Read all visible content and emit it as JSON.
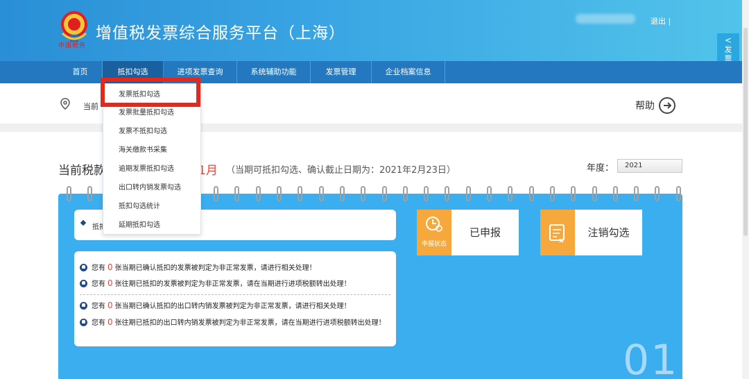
{
  "header": {
    "title": "增值税发票综合服务平台（上海）",
    "logo_script": "中国税务",
    "logout": "退出 |"
  },
  "nav": [
    {
      "label": "首页"
    },
    {
      "label": "抵扣勾选"
    },
    {
      "label": "进项发票查询"
    },
    {
      "label": "系统辅助功能"
    },
    {
      "label": "发票管理"
    },
    {
      "label": "企业档案信息"
    }
  ],
  "side_tab": {
    "label": "发票查验平台",
    "arrow": "<"
  },
  "breadcrumb": {
    "label": "当前"
  },
  "help": {
    "label": "帮助"
  },
  "dropdown": {
    "items": [
      {
        "label": "发票抵扣勾选"
      },
      {
        "label": "发票批量抵扣勾选"
      },
      {
        "label": "发票不抵扣勾选"
      },
      {
        "label": "海关缴款书采集"
      },
      {
        "label": "逾期发票抵扣勾选"
      },
      {
        "label": "出口转内销发票勾选"
      },
      {
        "label": "抵扣勾选统计"
      },
      {
        "label": "延期抵扣勾选"
      }
    ]
  },
  "period": {
    "title_prefix": "当前税款",
    "month": "1月",
    "note": "（当期可抵扣勾选、确认截止日期为：2021年2月23日）",
    "year_label": "年度：",
    "year_value": "2021"
  },
  "card1": {
    "text": "抵扣"
  },
  "notices": [
    {
      "pre": "您有",
      "count": "0",
      "post": "张当期已确认抵扣的发票被判定为非正常发票，请进行相关处理！"
    },
    {
      "pre": "您有",
      "count": "0",
      "post": "张往期已抵扣的发票被判定为非正常发票，请在当期进行进项税额转出处理！"
    },
    {
      "pre": "您有",
      "count": "0",
      "post": "张当期已确认抵扣的出口转内销发票被判定为非正常发票，请进行相关处理！"
    },
    {
      "pre": "您有",
      "count": "0",
      "post": "张往期已抵扣的出口转内销发票被判定为非正常发票，请在当期进行进项税额转出处理！"
    }
  ],
  "tiles": [
    {
      "label": "已申报",
      "caption": "申报状态",
      "icon": "status-icon"
    },
    {
      "label": "注销勾选",
      "caption": "",
      "icon": "cancel-icon"
    }
  ],
  "step_number": "01",
  "colors": {
    "header": "#2a8fd6",
    "nav": "#2378bf",
    "panel": "#3baef0",
    "accent_red": "#e0483a",
    "tile_orange": "#f6a83c"
  }
}
